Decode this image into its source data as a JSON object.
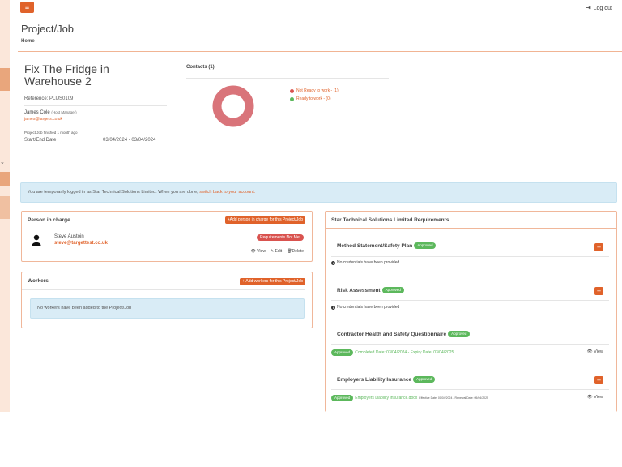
{
  "topbar": {
    "menu_glyph": "≡",
    "logout_icon": "⇥",
    "logout_label": "Log out"
  },
  "page": {
    "title": "Project/Job",
    "breadcrumb": "Home"
  },
  "project": {
    "title": "Fix The Fridge in Warehouse 2",
    "reference": "Reference: PLIJS0109",
    "manager_name": "James Cole",
    "manager_role": "(Host Manager)",
    "manager_email": "james@targets.co.uk",
    "status": "Project/Job finished 1 month ago",
    "dates_label": "Start/End Date",
    "dates_value": "03/04/2024 - 03/04/2024"
  },
  "contacts": {
    "title": "Contacts (1)",
    "legend": [
      {
        "label": "Not Ready to work - (1)",
        "color": "#d9534f"
      },
      {
        "label": "Ready to work - (0)",
        "color": "#5cb85c"
      }
    ],
    "not_ready_count": 1,
    "ready_count": 0,
    "donut_color": "#d9747a"
  },
  "banner": {
    "text": "You are temporarily logged in as Star Technical Solutions Limited. When you are done,",
    "link": "switch back to your account."
  },
  "person_in_charge": {
    "title": "Person in charge",
    "add_button": "+Add person in charge for this Project/Job",
    "name": "Steve Austoin",
    "email": "steve@targettest.co.uk",
    "status_badge": "Requirements Not Met",
    "view": "View",
    "edit": "Edit",
    "delete": "Delete"
  },
  "workers": {
    "title": "Workers",
    "add_button": "+ Add workers for this Project/Job",
    "empty_message": "No workers have been added to the Project/Job"
  },
  "requirements": {
    "title": "Star Technical Solutions Limited Requirements",
    "items": [
      {
        "title": "Method Statement/Safety Plan",
        "badge": "Approved",
        "note": "No credentials have been provided"
      },
      {
        "title": "Risk Assessment",
        "badge": "Approved",
        "note": "No credentials have been provided"
      },
      {
        "title": "Contractor Health and Safety Questionnaire",
        "badge": "Approved",
        "detail_badge": "Approved",
        "detail": "Completed Date: 03/04/2024 - Expiry Date: 03/04/2025",
        "view": "View"
      },
      {
        "title": "Employers Liability Insurance",
        "badge": "Approved",
        "detail_badge": "Approved",
        "detail": "Employers Liability Insurance.docx",
        "detail_extra": "Effective Date: 01/04/2024 - Renewal Date: 05/04/2025",
        "view": "View"
      }
    ]
  },
  "colors": {
    "accent": "#e0622a",
    "approved": "#5cb85c",
    "danger": "#d9534f",
    "info_bg": "#d9ecf6"
  }
}
